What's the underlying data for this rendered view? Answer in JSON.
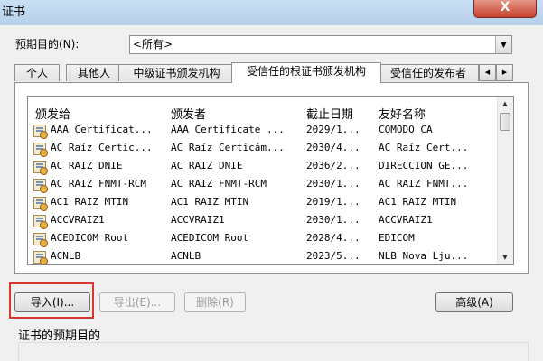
{
  "window": {
    "title": "证书",
    "close_label": "X"
  },
  "purpose": {
    "label": "预期目的(N):",
    "selected": "<所有>",
    "arrow_icon": "chevron-down-icon"
  },
  "tabs": [
    {
      "label": "个人"
    },
    {
      "label": "其他人"
    },
    {
      "label": "中级证书颁发机构"
    },
    {
      "label": "受信任的根证书颁发机构",
      "active": true
    },
    {
      "label": "受信任的发布者"
    }
  ],
  "tab_scroll": {
    "left": "◀",
    "right": "▶"
  },
  "list": {
    "columns": [
      "颁发给",
      "颁发者",
      "截止日期",
      "友好名称"
    ],
    "rows": [
      {
        "issued_to": "AAA Certificat...",
        "issued_by": "AAA Certificate ...",
        "expires": "2029/1...",
        "friendly_name": "COMODO CA"
      },
      {
        "issued_to": "AC Raíz Certic...",
        "issued_by": "AC Raíz Certicám...",
        "expires": "2030/4...",
        "friendly_name": "AC Raíz Cert..."
      },
      {
        "issued_to": "AC RAIZ DNIE",
        "issued_by": "AC RAIZ DNIE",
        "expires": "2036/2...",
        "friendly_name": "DIRECCION GE..."
      },
      {
        "issued_to": "AC RAIZ FNMT-RCM",
        "issued_by": "AC RAIZ FNMT-RCM",
        "expires": "2030/1...",
        "friendly_name": "AC RAIZ FNMT..."
      },
      {
        "issued_to": "AC1 RAIZ MTIN",
        "issued_by": "AC1 RAIZ MTIN",
        "expires": "2019/1...",
        "friendly_name": "AC1 RAIZ MTIN"
      },
      {
        "issued_to": "ACCVRAIZ1",
        "issued_by": "ACCVRAIZ1",
        "expires": "2030/1...",
        "friendly_name": "ACCVRAIZ1"
      },
      {
        "issued_to": "ACEDICOM Root",
        "issued_by": "ACEDICOM Root",
        "expires": "2028/4...",
        "friendly_name": "EDICOM"
      },
      {
        "issued_to": "ACNLB",
        "issued_by": "ACNLB",
        "expires": "2023/5...",
        "friendly_name": "NLB Nova Lju..."
      }
    ],
    "scroll_up": "▲",
    "scroll_down": "▼"
  },
  "buttons": {
    "import": "导入(I)...",
    "export": "导出(E)...",
    "delete": "删除(R)",
    "advanced": "高级(A)"
  },
  "purposes_section": {
    "label": "证书的预期目的"
  },
  "colors": {
    "highlight": "#d9372a",
    "close_button": "#c7412b"
  }
}
